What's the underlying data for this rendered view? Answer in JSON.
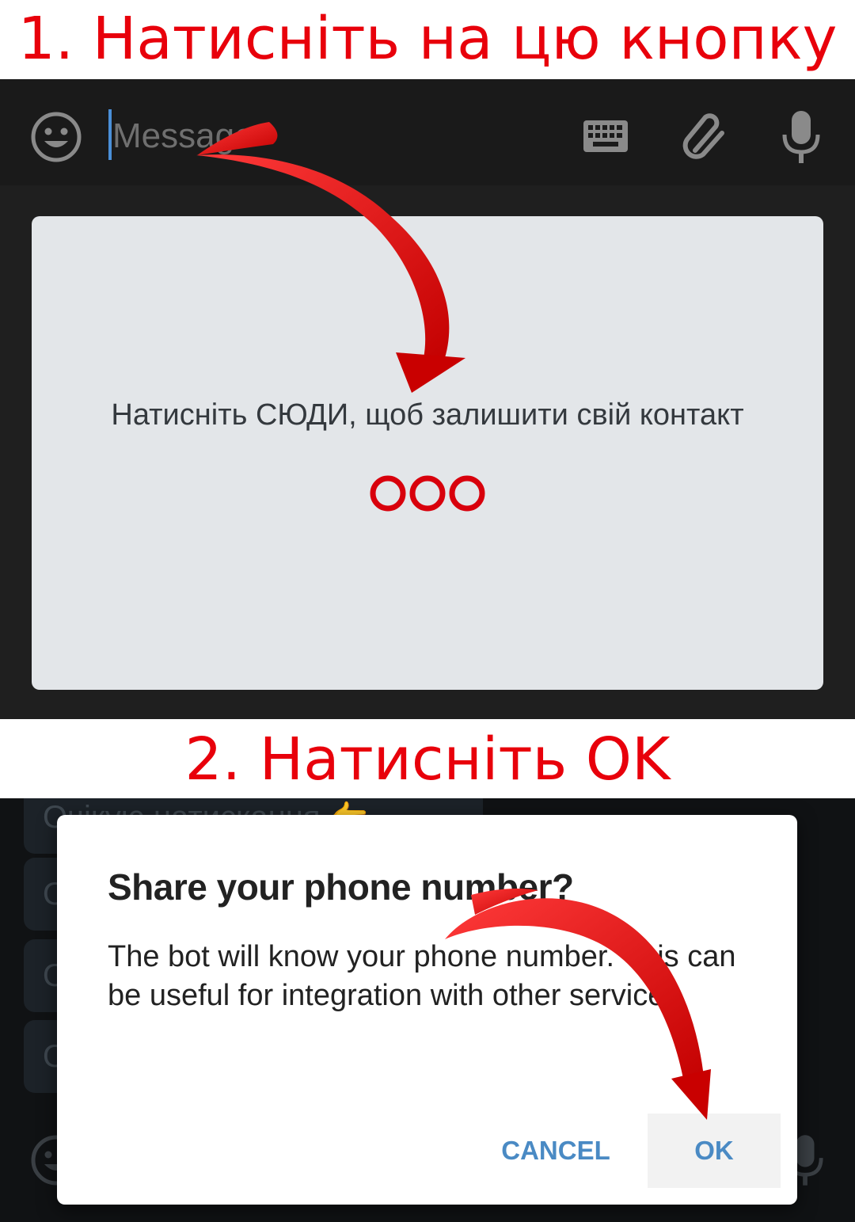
{
  "steps": {
    "step1_text": "1. Натисніть на цю кнопку",
    "step2_text": "2. Натисніть OK"
  },
  "chat_input": {
    "placeholder": "Message",
    "icons": [
      "smile-icon",
      "keyboard-icon",
      "paperclip-icon",
      "microphone-icon"
    ]
  },
  "bot_keyboard": {
    "button_label": "Натисніть СЮДИ, щоб залишити свій контакт",
    "glyph": "⭕⭕⭕"
  },
  "background_chat": {
    "bubbles": [
      "Очікую натискання 👉",
      "О",
      "О",
      "О"
    ]
  },
  "dialog": {
    "title": "Share your phone number?",
    "body": "The bot will know your phone number. This can be useful for integration with other services.",
    "cancel_label": "CANCEL",
    "ok_label": "OK"
  },
  "colors": {
    "instruction_red": "#e8000b",
    "dark_bg": "#1f1f1f",
    "keyboard_panel": "#e3e6e9",
    "button_blue": "#4a8ac4",
    "arrow_red": "#d90c0c"
  }
}
